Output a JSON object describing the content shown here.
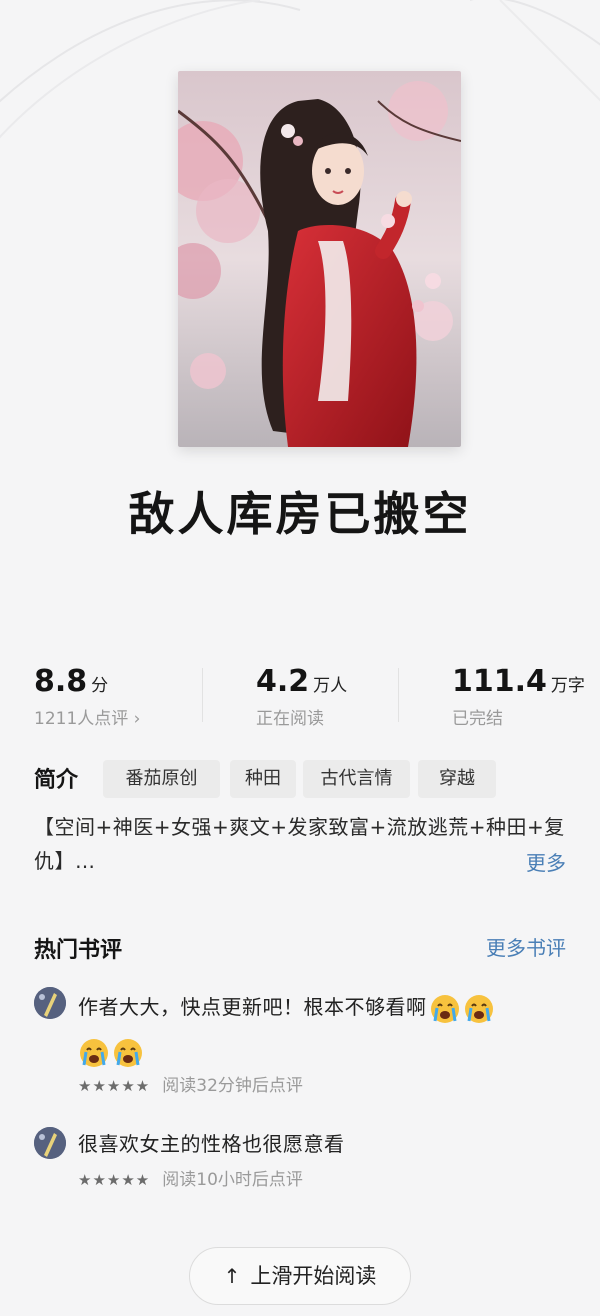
{
  "book": {
    "title": "敌人库房已搬空"
  },
  "stats": {
    "rating_value": "8.8",
    "rating_unit": "分",
    "rating_sub": "1211人点评 ›",
    "readers_value": "4.2",
    "readers_unit": "万人",
    "readers_sub": "正在阅读",
    "words_value": "111.4",
    "words_unit": "万字",
    "words_sub": "已完结"
  },
  "intro": {
    "label": "简介",
    "tags": [
      "番茄原创",
      "种田",
      "古代言情",
      "穿越"
    ],
    "text": "【空间+神医+女强+爽文+发家致富+流放逃荒+种田+复仇】…",
    "more": "更多"
  },
  "reviews": {
    "title": "热门书评",
    "more": "更多书评",
    "items": [
      {
        "text": "作者大大，快点更新吧！根本不够看啊",
        "stars": "★★★★★",
        "meta": "阅读32分钟后点评"
      },
      {
        "text": "很喜欢女主的性格也很愿意看",
        "stars": "★★★★★",
        "meta": "阅读10小时后点评"
      }
    ]
  },
  "start_reading": {
    "arrow": "↑",
    "label": "上滑开始阅读"
  },
  "colors": {
    "background": "#f5f5f6",
    "link": "#4a7fb6",
    "muted": "#9a9a9a",
    "cover_red": "#c2262c"
  }
}
